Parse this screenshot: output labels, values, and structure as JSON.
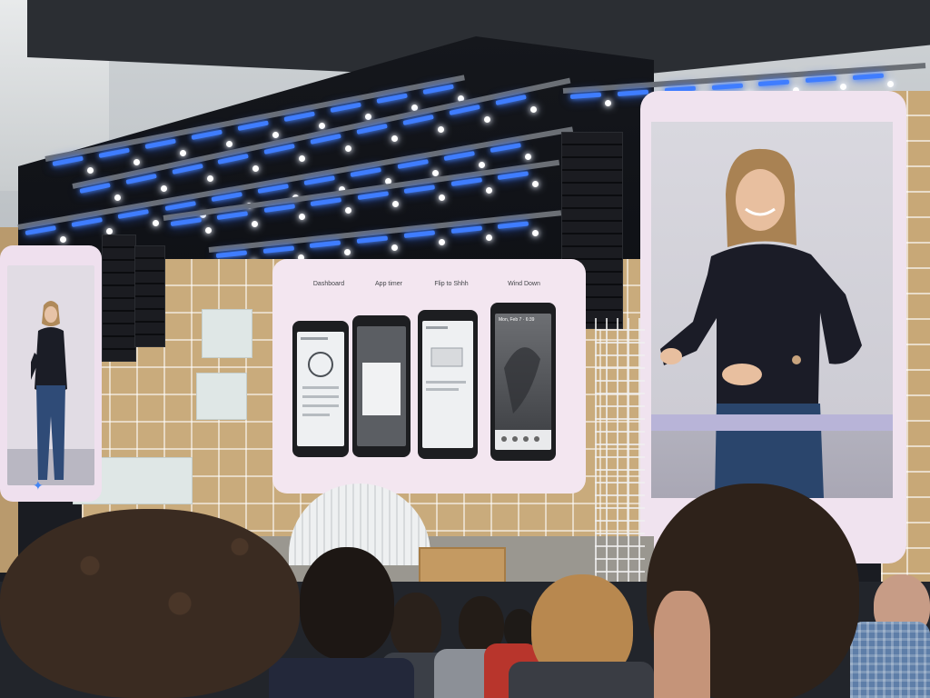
{
  "scene": {
    "description_tag": ""
  },
  "center_screen": {
    "labels": [
      "Dashboard",
      "App timer",
      "Flip to Shhh",
      "Wind Down"
    ],
    "wind_down_time": "Mon, Feb 7 · 6:39"
  },
  "left_screen": {
    "logo_text": "✦"
  },
  "colors": {
    "stage_light_blue": "#3f7dff",
    "screen_frame_pink": "#f0e3ef",
    "wall_wood": "#c9ab7c"
  }
}
